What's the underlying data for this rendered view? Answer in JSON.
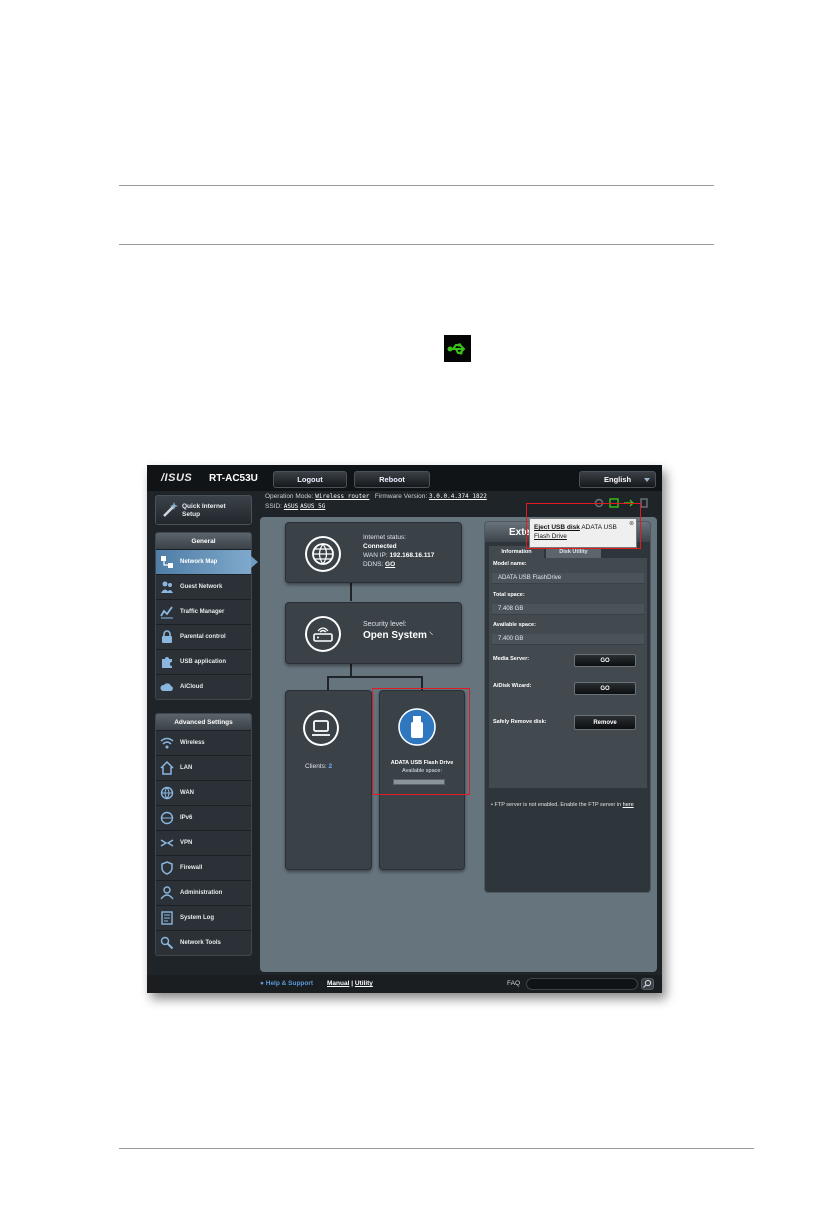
{
  "topbar": {
    "logo": "/ISUS",
    "model": "RT-AC53U",
    "logout": "Logout",
    "reboot": "Reboot",
    "language": "English"
  },
  "info": {
    "op_mode_label": "Operation Mode:",
    "op_mode_value": "Wireless router",
    "fw_label": "Firmware Version:",
    "fw_value": "3.0.0.4.374_1822",
    "ssid_label": "SSID:",
    "ssid_1": "ASUS",
    "ssid_2": "ASUS_5G"
  },
  "sidebar": {
    "quick_setup": "Quick Internet Setup",
    "general_header": "General",
    "general_items": [
      {
        "label": "Network Map",
        "icon": "network-map-icon"
      },
      {
        "label": "Guest Network",
        "icon": "guest-network-icon"
      },
      {
        "label": "Traffic Manager",
        "icon": "traffic-manager-icon"
      },
      {
        "label": "Parental control",
        "icon": "lock-icon"
      },
      {
        "label": "USB application",
        "icon": "puzzle-icon"
      },
      {
        "label": "AiCloud",
        "icon": "cloud-icon"
      }
    ],
    "advanced_header": "Advanced Settings",
    "advanced_items": [
      {
        "label": "Wireless",
        "icon": "wifi-icon"
      },
      {
        "label": "LAN",
        "icon": "home-icon"
      },
      {
        "label": "WAN",
        "icon": "globe-icon"
      },
      {
        "label": "IPv6",
        "icon": "ipv6-icon"
      },
      {
        "label": "VPN",
        "icon": "vpn-icon"
      },
      {
        "label": "Firewall",
        "icon": "shield-icon"
      },
      {
        "label": "Administration",
        "icon": "admin-icon"
      },
      {
        "label": "System Log",
        "icon": "log-icon"
      },
      {
        "label": "Network Tools",
        "icon": "tools-icon"
      }
    ]
  },
  "map": {
    "internet_status_label": "Internet status:",
    "internet_status_value": "Connected",
    "wan_ip_label": "WAN IP:",
    "wan_ip_value": "192.168.16.117",
    "ddns_label": "DDNS:",
    "ddns_value": "GO",
    "security_label": "Security level:",
    "security_value": "Open System",
    "clients_label": "Clients:",
    "clients_value": "2",
    "usb_name": "ADATA USB Flash Drive",
    "usb_space_label": "Available space:"
  },
  "ext": {
    "title": "Exte",
    "tab_info": "Information",
    "tab_disk": "Disk Utility",
    "model_label": "Model name:",
    "model_value": "ADATA USB FlashDrive",
    "total_label": "Total space:",
    "total_value": "7.408 GB",
    "avail_label": "Available space:",
    "avail_value": "7.400 GB",
    "media_label": "Media Server:",
    "media_btn": "GO",
    "aidisk_label": "AiDisk Wizard:",
    "aidisk_btn": "GO",
    "remove_label": "Safely Remove disk:",
    "remove_btn": "Remove",
    "note_text": "FTP server is not enabled. Enable the FTP server in",
    "note_link": "here"
  },
  "tooltip": {
    "bold": "Eject USB disk",
    "text": "ADATA USB",
    "text2": "Flash Drive",
    "close": "⊗"
  },
  "bottom": {
    "help": "Help & Support",
    "manual": "Manual",
    "sep": "|",
    "utility": "Utility",
    "faq": "FAQ"
  },
  "colors": {
    "usb_green": "#39c21a",
    "highlight_red": "#e01b24",
    "active_blue": "#5a8ab3"
  }
}
